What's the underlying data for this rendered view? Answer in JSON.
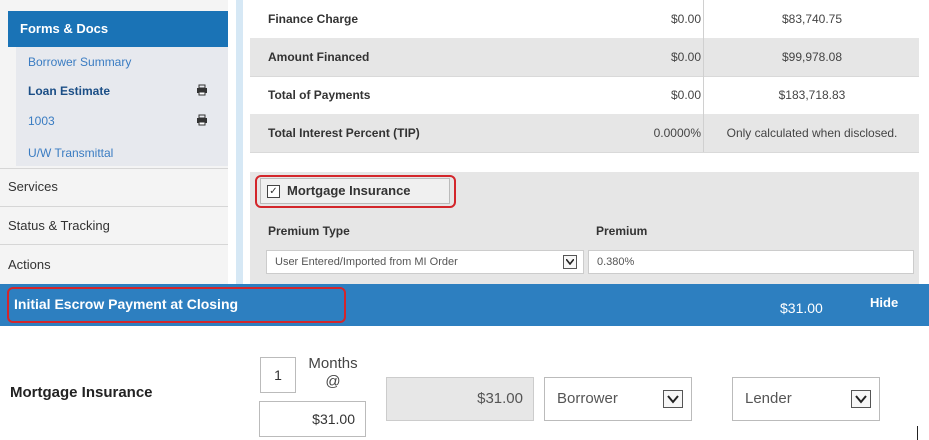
{
  "sidebar": {
    "header": "Forms & Docs",
    "sub_items": [
      {
        "label": "Borrower Summary"
      },
      {
        "label": "Loan Estimate"
      },
      {
        "label": "1003"
      },
      {
        "label": "U/W Transmittal"
      }
    ],
    "items": [
      {
        "label": "Services"
      },
      {
        "label": "Status & Tracking"
      },
      {
        "label": "Actions"
      }
    ]
  },
  "disclosure_table": {
    "rows": [
      {
        "label": "Finance Charge",
        "value1": "$0.00",
        "value2": "$83,740.75"
      },
      {
        "label": "Amount Financed",
        "value1": "$0.00",
        "value2": "$99,978.08"
      },
      {
        "label": "Total of Payments",
        "value1": "$0.00",
        "value2": "$183,718.83"
      },
      {
        "label": "Total Interest Percent (TIP)",
        "value1": "0.0000%",
        "value2": "Only calculated when disclosed."
      }
    ]
  },
  "mortgage_insurance_panel": {
    "checkbox_label": "Mortgage Insurance",
    "checked": true,
    "premium_type_header": "Premium Type",
    "premium_header": "Premium",
    "premium_type_value": "User Entered/Imported from MI Order",
    "premium_value": "0.380%"
  },
  "escrow": {
    "title": "Initial Escrow Payment at Closing",
    "amount": "$31.00",
    "hide_label": "Hide"
  },
  "mi_row": {
    "label": "Mortgage Insurance",
    "months_value": "1",
    "months_label_line1": "Months",
    "months_label_line2": "@",
    "rate_value": "$31.00",
    "total_value": "$31.00",
    "payer1": "Borrower",
    "payer2": "Lender"
  },
  "colors": {
    "accent_blue": "#1a73b6",
    "escrow_bar": "#2d7fc0",
    "highlight_red": "#d3262b"
  },
  "icons": [
    "printer-icon",
    "checkbox-checked-icon",
    "chevron-down-icon"
  ]
}
